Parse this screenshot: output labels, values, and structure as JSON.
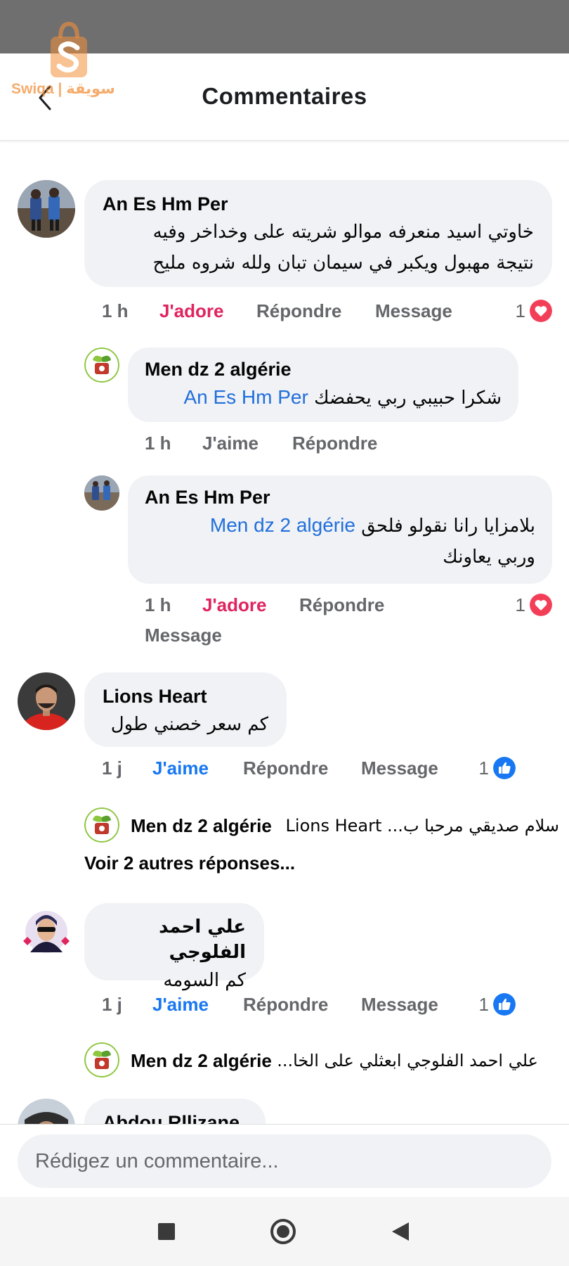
{
  "watermark": {
    "text": "Swiqa | سويقة"
  },
  "header": {
    "title": "Commentaires"
  },
  "comments": [
    {
      "author": "An Es Hm Per",
      "text_line1": "خاوتي اسيد منعرفه موالو شريته على وخداخر وفيه",
      "text_line2": "نتيجة مهبول ويكبر في سيمان تبان ولله شروه مليح",
      "time": "1 h",
      "like": "J'adore",
      "reply": "Répondre",
      "message": "Message",
      "reactions": "1"
    },
    {
      "author": "Men dz 2 algérie",
      "mention": "An Es Hm Per",
      "text": "شكرا حبيبي ربي يحفضك",
      "time": "1 h",
      "like": "J'aime",
      "reply": "Répondre"
    },
    {
      "author": "An Es Hm Per",
      "mention": "Men dz 2 algérie",
      "text_line1": "بلامزايا رانا نقولو فلحق",
      "text_line2": "وربي يعاونك",
      "time": "1 h",
      "like": "J'adore",
      "reply": "Répondre",
      "message": "Message",
      "reactions": "1"
    },
    {
      "author": "Lions Heart",
      "text": "كم سعر خصني طول",
      "time": "1 j",
      "like": "J'aime",
      "reply": "Répondre",
      "message": "Message",
      "reactions": "1",
      "preview_author": "Men dz 2 algérie",
      "preview_text": "سلام صديقي مرحبا ب... Lions Heart",
      "more_replies": "Voir 2 autres réponses..."
    },
    {
      "author": "علي احمد الفلوجي",
      "text": "كم السومه",
      "time": "1 j",
      "like": "J'aime",
      "reply": "Répondre",
      "message": "Message",
      "reactions": "1",
      "preview_author": "Men dz 2 algérie",
      "preview_text": "علي احمد الفلوجي ابعثلي على الخا..."
    },
    {
      "author": "Abdou Rllizane"
    }
  ],
  "compose": {
    "placeholder": "Rédigez un commentaire..."
  },
  "icons": {
    "back": "chevron-left-icon",
    "love": "heart-reaction-icon",
    "like": "thumbs-up-reaction-icon",
    "nav_recents": "square-icon",
    "nav_home": "circle-icon",
    "nav_back": "triangle-back-icon"
  },
  "colors": {
    "love": "#e0245e",
    "like": "#1877f2",
    "mention": "#216fdb",
    "bubble": "#f0f2f5",
    "secondary_text": "#65676b",
    "statusbar": "#6f6f6f"
  }
}
